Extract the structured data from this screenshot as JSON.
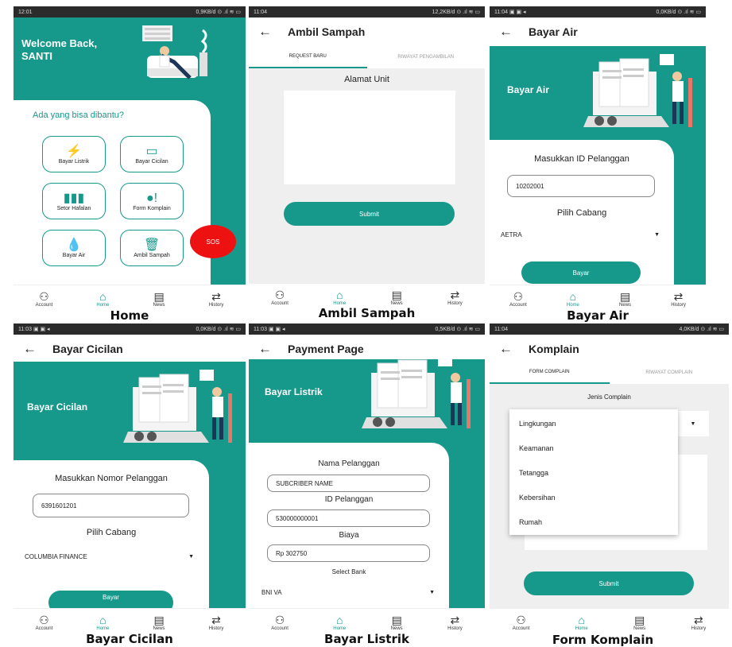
{
  "status_bars": {
    "home": {
      "time": "12:01",
      "right": "0,9KB/d ⊙ .ıl ≋ ▭"
    },
    "sampah": {
      "time": "11:04",
      "right": "12,2KB/d ⊙ .ıl ≋ ▭"
    },
    "air": {
      "time": "11:04 ▣ ▣ ◂",
      "right": "0,0KB/d ⊙ .ıl ≋ ▭"
    },
    "cicilan": {
      "time": "11:03 ▣ ▣ ◂",
      "right": "0,0KB/d ⊙ .ıl ≋ ▭"
    },
    "listrik": {
      "time": "11:03 ▣ ▣ ◂",
      "right": "0,5KB/d ⊙ .ıl ≋ ▭"
    },
    "komplain": {
      "time": "11:04",
      "right": "4,0KB/d ⊙ .ıl ≋ ▭"
    }
  },
  "nav": {
    "account": "Account",
    "home": "Home",
    "news": "News",
    "history": "History"
  },
  "home": {
    "welcome": "Welcome Back,",
    "name": "SANTI",
    "question": "Ada yang bisa dibantu?",
    "tiles": [
      "Bayar Listrik",
      "Bayar Cicilan",
      "Setor Hafalan",
      "Form Komplain",
      "Bayar Air",
      "Ambil Sampah"
    ],
    "sos": "SOS",
    "caption": "Home"
  },
  "sampah": {
    "title": "Ambil Sampah",
    "tab_active": "REQUEST BARU",
    "tab_inactive": "RIWAYAT PENGAMBILAN",
    "label": "Alamat Unit",
    "submit": "Submit",
    "caption": "Ambil Sampah"
  },
  "air": {
    "title": "Bayar Air",
    "banner": "Bayar Air",
    "label_id": "Masukkan ID Pelanggan",
    "id_value": "10202001",
    "label_cabang": "Pilih Cabang",
    "cabang": "AETRA",
    "button": "Bayar",
    "caption": "Bayar Air"
  },
  "cicilan": {
    "title": "Bayar Cicilan",
    "banner": "Bayar Cicilan",
    "label_nomor": "Masukkan Nomor Pelanggan",
    "nomor_value": "6391601201",
    "label_cabang": "Pilih Cabang",
    "cabang": "COLUMBIA FINANCE",
    "button": "Bayar",
    "caption": "Bayar Cicilan"
  },
  "listrik": {
    "title": "Payment Page",
    "banner": "Bayar Listrik",
    "label_nama": "Nama Pelanggan",
    "nama_value": "SUBCRIBER NAME",
    "label_id": "ID Pelanggan",
    "id_value": "530000000001",
    "label_biaya": "Biaya",
    "biaya_value": "Rp 302750",
    "label_bank": "Select Bank",
    "bank": "BNI VA",
    "caption": "Bayar Listrik"
  },
  "komplain": {
    "title": "Komplain",
    "tab_active": "FORM COMPLAIN",
    "tab_inactive": "RIWAYAT COMPLAIN",
    "label": "Jenis Complain",
    "options": [
      "Lingkungan",
      "Keamanan",
      "Tetangga",
      "Kebersihan",
      "Rumah"
    ],
    "submit": "Submit",
    "caption": "Form Komplain"
  },
  "colors": {
    "teal": "#16988b",
    "sos_red": "#ee1111"
  },
  "icons": {
    "back": "arrow-left-icon",
    "account": "person-icon",
    "home": "house-icon",
    "news": "newspaper-icon",
    "history": "swap-arrows-icon",
    "dropdown": "caret-down-icon"
  }
}
